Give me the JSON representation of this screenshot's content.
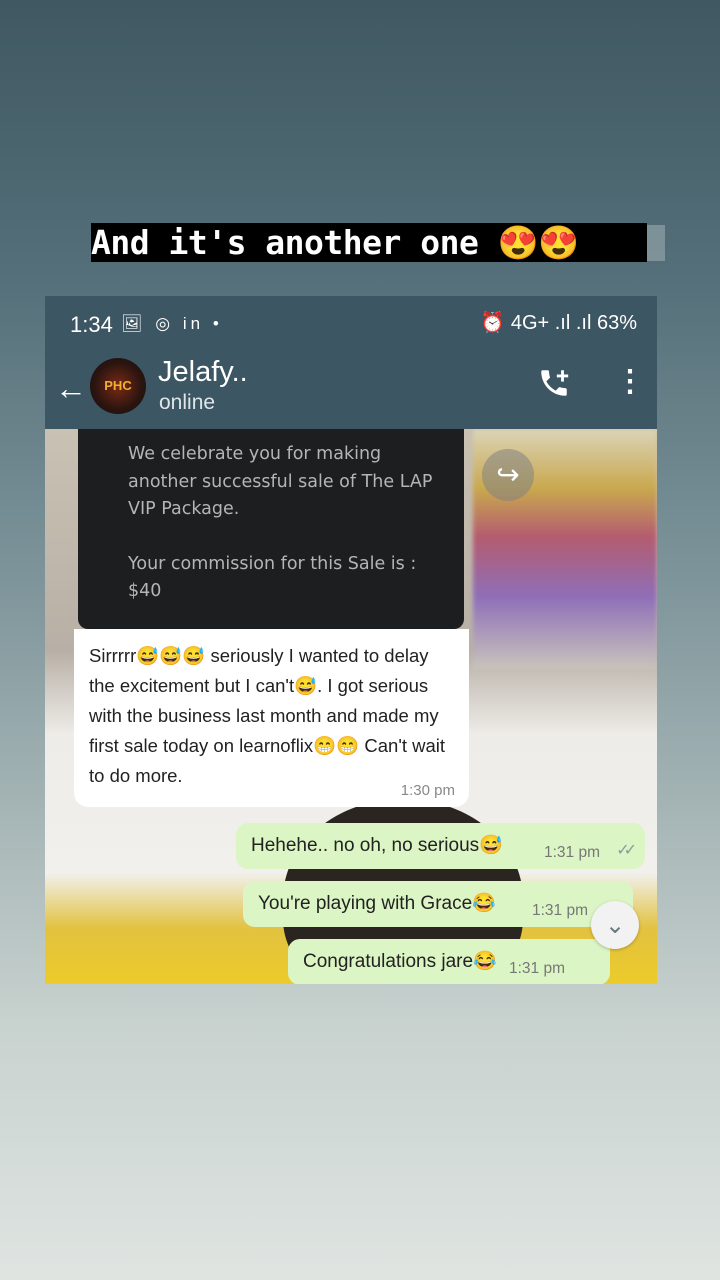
{
  "caption": {
    "text": "And it's another one 😍😍"
  },
  "status_bar": {
    "time": "1:34",
    "left_icons": "🖼 ◎ in •",
    "right_icons": "⏰ 4G+ .ıl .ıl",
    "battery": "63%"
  },
  "header": {
    "back_icon": "arrow-left",
    "avatar_text": "PHC",
    "contact_name": "Jelafy..",
    "contact_status": "online",
    "call_icon": "phone-plus",
    "menu_icon": "more-vert"
  },
  "messages": {
    "image_card": {
      "line1": "We celebrate you for making another successful sale of The LAP VIP Package.",
      "line2": "Your commission for this Sale is : $40"
    },
    "incoming": {
      "text": "Sirrrrr😅😅😅 seriously I wanted to delay the excitement but I can't😅.  I got serious with the business last month and made my first sale today on learnoflix😁😁 Can't wait to do more.",
      "time": "1:30 pm"
    },
    "outgoing": [
      {
        "text": "Hehehe.. no oh, no serious😅",
        "time": "1:31 pm"
      },
      {
        "text": "You're playing with Grace😂",
        "time": "1:31 pm"
      },
      {
        "text": "Congratulations jare😂",
        "time": "1:31 pm"
      }
    ]
  },
  "colors": {
    "header_bg": "#3c5663",
    "outgoing_bubble": "#dcf5c4",
    "incoming_bubble": "#ffffff"
  }
}
